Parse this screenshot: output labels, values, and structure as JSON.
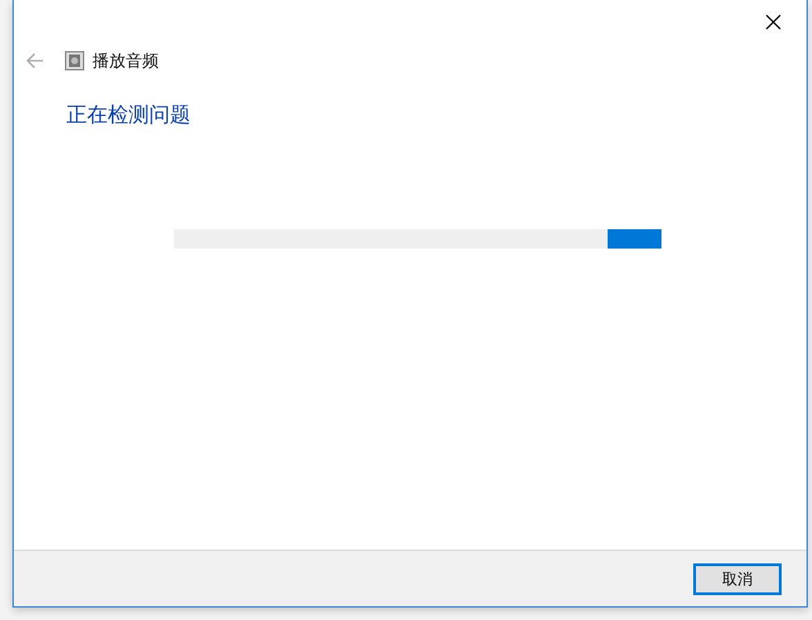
{
  "window": {
    "title": "播放音频",
    "back_disabled": true
  },
  "heading": "正在检测问题",
  "progress": {
    "kind": "marquee",
    "level": 1
  },
  "buttons": [
    {
      "label": "取消",
      "focused": true
    }
  ]
}
